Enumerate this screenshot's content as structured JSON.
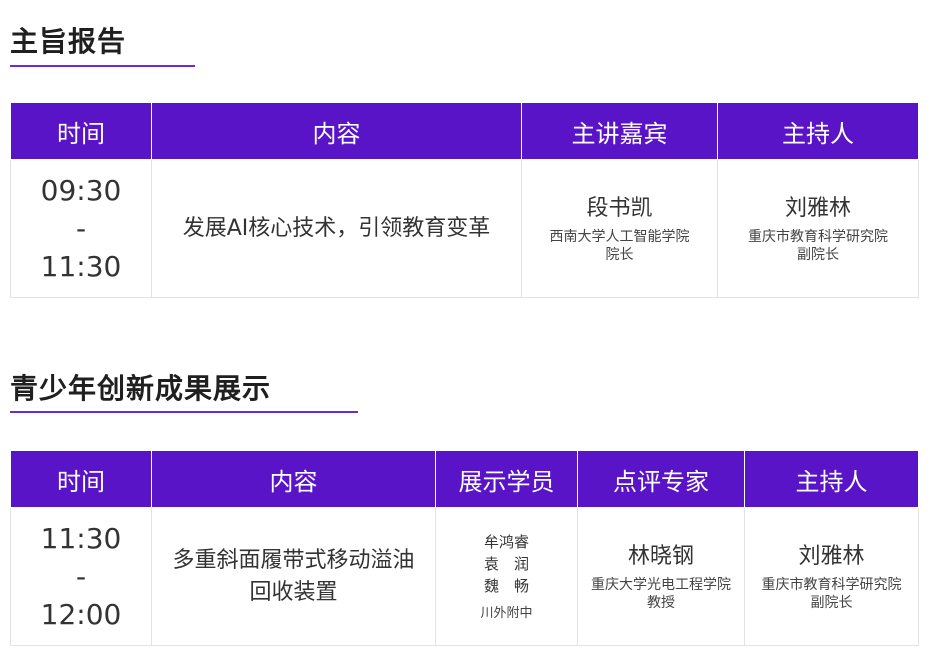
{
  "section1": {
    "title": "主旨报告",
    "headers": [
      "时间",
      "内容",
      "主讲嘉宾",
      "主持人"
    ],
    "row": {
      "time_start": "09:30",
      "time_sep": "-",
      "time_end": "11:30",
      "content": "发展AI核心技术，引领教育变革",
      "speaker_name": "段书凯",
      "speaker_affil_1": "西南大学人工智能学院",
      "speaker_affil_2": "院长",
      "host_name": "刘雅林",
      "host_affil_1": "重庆市教育科学研究院",
      "host_affil_2": "副院长"
    }
  },
  "section2": {
    "title": "青少年创新成果展示",
    "headers": [
      "时间",
      "内容",
      "展示学员",
      "点评专家",
      "主持人"
    ],
    "row": {
      "time_start": "11:30",
      "time_sep": "-",
      "time_end": "12:00",
      "content_line1": "多重斜面履带式移动溢油",
      "content_line2": "回收装置",
      "students": [
        "牟鸿睿",
        "袁　润",
        "魏　畅"
      ],
      "school": "川外附中",
      "expert_name": "林晓钢",
      "expert_affil_1": "重庆大学光电工程学院",
      "expert_affil_2": "教授",
      "host_name": "刘雅林",
      "host_affil_1": "重庆市教育科学研究院",
      "host_affil_2": "副院长"
    }
  },
  "colors": {
    "header_bg": "#5a14c8",
    "accent_line": "#6a2bd9"
  }
}
